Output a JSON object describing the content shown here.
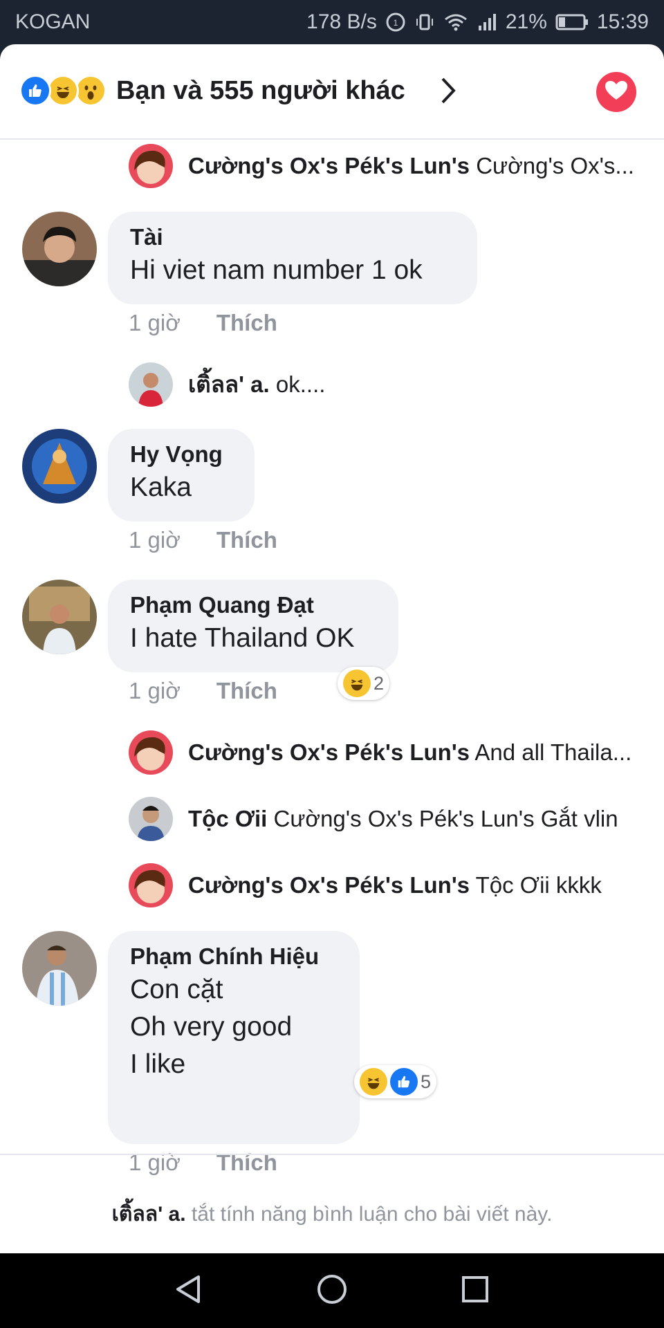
{
  "status_bar": {
    "carrier": "KOGAN",
    "net_speed": "178 B/s",
    "battery": "21%",
    "time": "15:39"
  },
  "header": {
    "reactions_text": "Bạn và 555 người khác",
    "icons": [
      "like-icon",
      "haha-icon",
      "wow-icon",
      "chevron-right-icon",
      "love-icon"
    ]
  },
  "comments": [
    {
      "replies": [
        {
          "name": "Cường's Ox's Pék's Lun's",
          "text": "Cường's Ox's..."
        }
      ]
    },
    {
      "author": "Tài",
      "lines": [
        "Hi viet nam number 1 ok"
      ],
      "time": "1 giờ",
      "like_label": "Thích",
      "replies": [
        {
          "name": "เติ้ลล' a.",
          "text": "ok...."
        }
      ]
    },
    {
      "author": "Hy Vọng",
      "lines": [
        "Kaka"
      ],
      "time": "1 giờ",
      "like_label": "Thích"
    },
    {
      "author": "Phạm Quang Đạt",
      "lines": [
        "I hate Thailand OK"
      ],
      "time": "1 giờ",
      "like_label": "Thích",
      "reaction_count": "2",
      "replies": [
        {
          "name": "Cường's Ox's Pék's Lun's",
          "text": "And all Thaila..."
        },
        {
          "name": "Tộc Ơii",
          "text": "Cường's Ox's Pék's Lun's Gắt vlin"
        },
        {
          "name": "Cường's Ox's Pék's Lun's",
          "text": "Tộc Ơii kkkk"
        }
      ]
    },
    {
      "author": "Phạm Chính Hiệu",
      "lines": [
        "Con cặt",
        "Oh very good",
        "I like"
      ],
      "time": "1 giờ",
      "like_label": "Thích",
      "reaction_count": "5"
    }
  ],
  "footer": {
    "name": "เติ้ลล' a.",
    "notice": "tắt tính năng bình luận cho bài viết này."
  },
  "colors": {
    "love": "#f33e58",
    "like": "#1877f2",
    "haha": "#f7c531",
    "bubble": "#f0f2f5"
  }
}
